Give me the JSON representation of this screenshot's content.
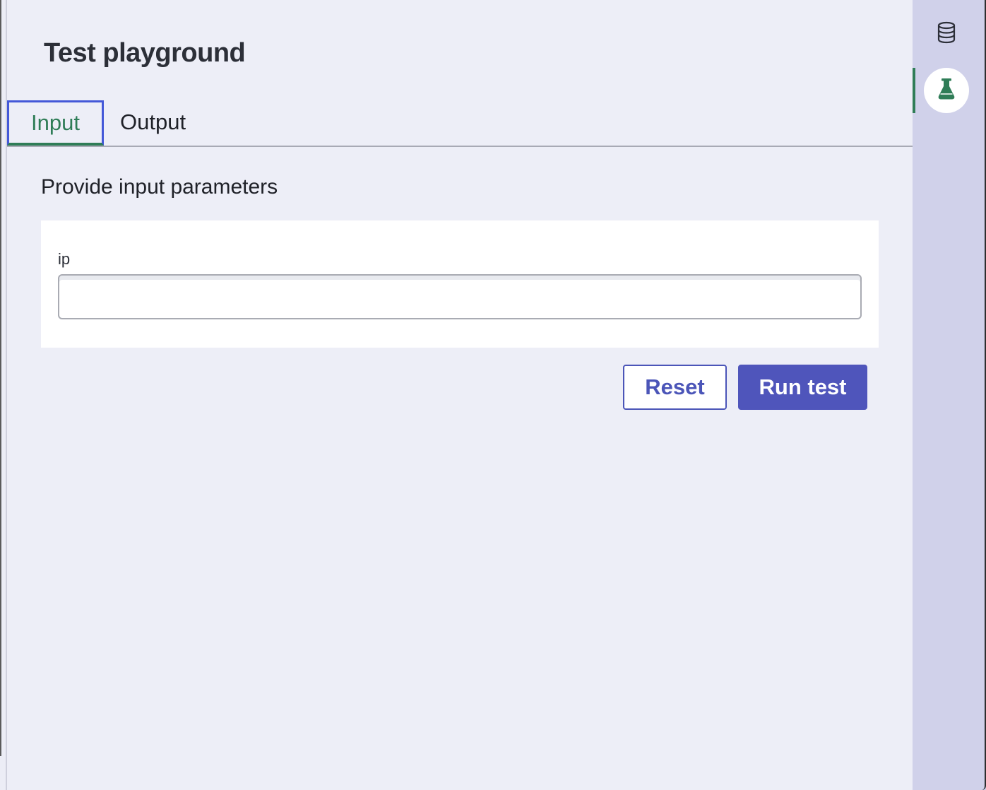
{
  "panel": {
    "title": "Test playground",
    "tabs": [
      {
        "label": "Input",
        "active": true
      },
      {
        "label": "Output",
        "active": false
      }
    ],
    "section_heading": "Provide input parameters",
    "fields": [
      {
        "label": "ip",
        "value": "",
        "placeholder": ""
      }
    ],
    "buttons": {
      "reset_label": "Reset",
      "run_label": "Run test"
    }
  },
  "rail": {
    "items": [
      {
        "icon": "database-icon",
        "active": false
      },
      {
        "icon": "flask-icon",
        "active": true
      }
    ]
  },
  "colors": {
    "accent_green": "#2f7d57",
    "primary_button": "#4f55bb",
    "focus_border": "#4458d8",
    "rail_background": "#d0d1ea",
    "panel_background": "#edeef7"
  }
}
